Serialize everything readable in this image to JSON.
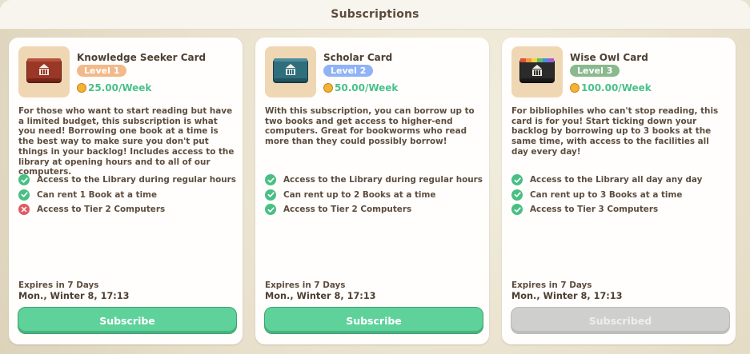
{
  "header": {
    "title": "Subscriptions"
  },
  "cards": [
    {
      "title": "Knowledge Seeker Card",
      "level": "Level 1",
      "level_color": "#f2b98a",
      "book_color": "#9a3726",
      "book_icon": "book-red-icon",
      "price": "25.00/Week",
      "description": "For those who want to start reading but have a limited budget, this subscription is what you need! Borrowing one book at a time is the best way to make sure you don't put things in your backlog! Includes access to the library at opening hours and to all of our computers.",
      "features": [
        {
          "label": "Access to the Library during regular hours",
          "included": true
        },
        {
          "label": "Can rent 1 Book at a time",
          "included": true
        },
        {
          "label": "Access to Tier 2 Computers",
          "included": false
        }
      ],
      "expires": "Expires in 7 Days",
      "date": "Mon., Winter 8, 17:13",
      "button": "Subscribe"
    },
    {
      "title": "Scholar Card",
      "level": "Level 2",
      "level_color": "#8fb3f5",
      "book_color": "#2f6e7d",
      "book_icon": "book-teal-icon",
      "price": "50.00/Week",
      "description": "With this subscription, you can borrow up to two books and get access to higher-end computers. Great for bookworms who read more than they could possibly borrow!",
      "features": [
        {
          "label": "Access to the Library during regular hours",
          "included": true
        },
        {
          "label": "Can rent up to 2 Books at a time",
          "included": true
        },
        {
          "label": "Access to Tier 2 Computers",
          "included": true
        }
      ],
      "expires": "Expires in 7 Days",
      "date": "Mon., Winter 8, 17:13",
      "button": "Subscribe"
    },
    {
      "title": "Wise Owl Card",
      "level": "Level 3",
      "level_color": "#8bb98e",
      "book_color": "#2b2b2b",
      "book_icon": "book-rainbow-icon",
      "price": "100.00/Week",
      "description": "For bibliophiles who can't stop reading, this card is for you! Start ticking down your backlog by borrowing up to 3 books at the same time, with access to the facilities all day every day!",
      "features": [
        {
          "label": "Access to the Library all day any day",
          "included": true
        },
        {
          "label": "Can rent up to 3 Books at a time",
          "included": true
        },
        {
          "label": "Access to Tier 3 Computers",
          "included": true
        }
      ],
      "expires": "Expires in 7 Days",
      "date": "Mon., Winter 8, 17:13",
      "button": "Subscribed"
    }
  ],
  "colors": {
    "accent": "#5ed29a",
    "price": "#48c08c",
    "check": "#49bf84",
    "cross": "#e05a63"
  }
}
